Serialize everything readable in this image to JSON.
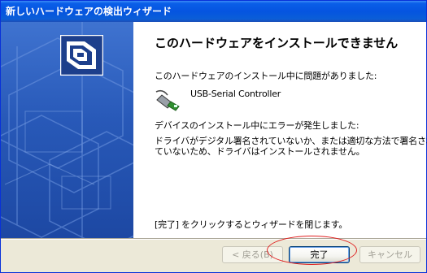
{
  "window": {
    "title": "新しいハードウェアの検出ウィザード"
  },
  "main": {
    "heading": "このハードウェアをインストールできません",
    "problem_text": "このハードウェアのインストール中に問題がありました:",
    "device_name": "USB-Serial Controller",
    "error_text": "デバイスのインストール中にエラーが発生しました:",
    "detail_line1": "ドライバがデジタル署名されていないか、または適切な方法で署名され",
    "detail_line2": "ていないため、ドライバはインストールされません。",
    "finish_hint": "[完了] をクリックするとウィザードを閉じます。"
  },
  "buttons": {
    "back": "< 戻る(B)",
    "finish": "完了",
    "cancel": "キャンセル"
  },
  "colors": {
    "annotation_oval": "#e02020",
    "titlebar": "#0554e0"
  }
}
